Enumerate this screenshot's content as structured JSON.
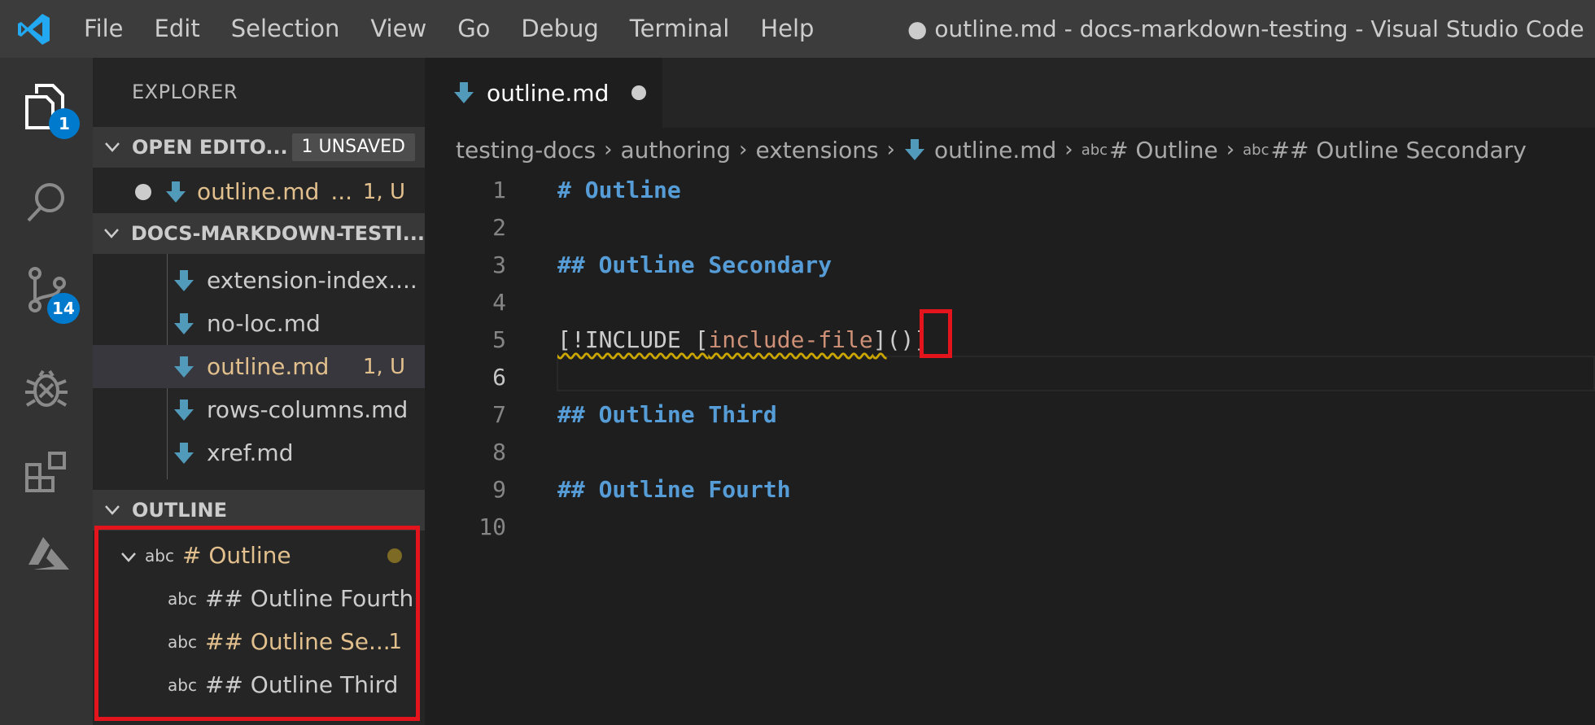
{
  "titlebar": {
    "menu": [
      "File",
      "Edit",
      "Selection",
      "View",
      "Go",
      "Debug",
      "Terminal",
      "Help"
    ],
    "window_title": "● outline.md - docs-markdown-testing - Visual Studio Code"
  },
  "activitybar": {
    "explorer_badge": "1",
    "scm_badge": "14"
  },
  "sidebar": {
    "title": "EXPLORER",
    "open_editors": {
      "header": "OPEN EDITO...",
      "badge": "1 UNSAVED",
      "file": "outline.md",
      "file_suffix": "...",
      "file_status": "1, U"
    },
    "workspace": {
      "header": "DOCS-MARKDOWN-TESTI...",
      "files": [
        {
          "name": "extension-index....",
          "status": ""
        },
        {
          "name": "no-loc.md",
          "status": ""
        },
        {
          "name": "outline.md",
          "status": "1, U"
        },
        {
          "name": "rows-columns.md",
          "status": ""
        },
        {
          "name": "xref.md",
          "status": ""
        }
      ]
    },
    "outline": {
      "header": "OUTLINE",
      "symbol_prefix": "abc",
      "items": [
        {
          "label": "# Outline",
          "status": ""
        },
        {
          "label": "## Outline Fourth",
          "status": ""
        },
        {
          "label": "## Outline Se...",
          "status": "1"
        },
        {
          "label": "## Outline Third",
          "status": ""
        }
      ]
    }
  },
  "editor": {
    "tab_label": "outline.md",
    "breadcrumb": [
      "testing-docs",
      "authoring",
      "extensions",
      "outline.md",
      "# Outline",
      "## Outline Secondary"
    ],
    "breadcrumb_abc": "abc",
    "lines": [
      {
        "n": "1",
        "text": "# Outline"
      },
      {
        "n": "2",
        "text": ""
      },
      {
        "n": "3",
        "text": "## Outline Secondary"
      },
      {
        "n": "4",
        "text": ""
      },
      {
        "n": "5",
        "prefix": "[!INCLUDE ",
        "open": "[",
        "link": "include-file",
        "close": "]",
        "paren": "()",
        "end": "]"
      },
      {
        "n": "6",
        "text": ""
      },
      {
        "n": "7",
        "text": "## Outline Third"
      },
      {
        "n": "8",
        "text": ""
      },
      {
        "n": "9",
        "text": "## Outline Fourth"
      },
      {
        "n": "10",
        "text": ""
      }
    ]
  },
  "colors": {
    "accent": "#007acc",
    "highlight_box": "#e3141c",
    "modified_yellow": "#e2c08d"
  }
}
